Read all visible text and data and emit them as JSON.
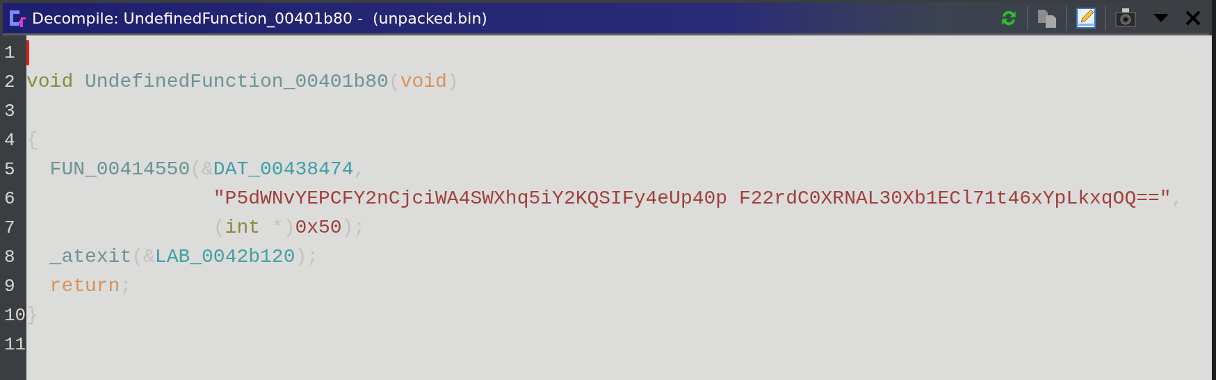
{
  "window": {
    "title": "Decompile: UndefinedFunction_00401b80 -  (unpacked.bin)"
  },
  "toolbar": [
    {
      "kind": "refresh"
    },
    {
      "kind": "copy"
    },
    {
      "kind": "edit"
    },
    {
      "kind": "snapshot"
    },
    {
      "kind": "menu"
    },
    {
      "kind": "close"
    }
  ],
  "editor": {
    "lines": [
      {
        "number": "1",
        "cursor": true
      },
      {
        "number": "2",
        "cursor": false,
        "tokens": [
          {
            "kind": "keyword",
            "text": "void"
          },
          {
            "kind": "space"
          },
          {
            "kind": "function",
            "text": "UndefinedFunction_00401b80"
          },
          {
            "kind": "punct",
            "text": "("
          },
          {
            "kind": "control",
            "text": "void"
          },
          {
            "kind": "punct",
            "text": ")"
          }
        ]
      },
      {
        "number": "3",
        "cursor": false
      },
      {
        "number": "4",
        "cursor": false,
        "tokens": [
          {
            "kind": "punct",
            "text": "{"
          }
        ]
      },
      {
        "number": "5",
        "cursor": false,
        "kind": "body",
        "tokens": [
          {
            "kind": "function",
            "text": "FUN_00414550"
          },
          {
            "kind": "punct",
            "text": "(&"
          },
          {
            "kind": "data",
            "text": "DAT_00438474"
          },
          {
            "kind": "punct",
            "text": ","
          }
        ]
      },
      {
        "number": "6",
        "cursor": false,
        "kind": "argument",
        "tokens": [
          {
            "kind": "string",
            "text": "\"P5dWNvYEPCFY2nCjciWA4SWXhq5iY2KQSIFy4eUp40p F22rdC0XRNAL30Xb1ECl71t46xYpLkxqOQ==\""
          },
          {
            "kind": "punct",
            "text": ","
          }
        ]
      },
      {
        "number": "7",
        "cursor": false,
        "kind": "argument",
        "tokens": [
          {
            "kind": "punct",
            "text": "("
          },
          {
            "kind": "keyword",
            "text": "int"
          },
          {
            "kind": "punct",
            "text": " *)"
          },
          {
            "kind": "number",
            "text": "0x50"
          },
          {
            "kind": "punct",
            "text": ");"
          }
        ]
      },
      {
        "number": "8",
        "cursor": false,
        "kind": "body",
        "tokens": [
          {
            "kind": "function",
            "text": "_atexit"
          },
          {
            "kind": "punct",
            "text": "(&"
          },
          {
            "kind": "data",
            "text": "LAB_0042b120"
          },
          {
            "kind": "punct",
            "text": ");"
          }
        ]
      },
      {
        "number": "9",
        "cursor": false,
        "kind": "body",
        "tokens": [
          {
            "kind": "control",
            "text": "return"
          },
          {
            "kind": "punct",
            "text": ";"
          }
        ]
      },
      {
        "number": "10",
        "cursor": false,
        "tokens": [
          {
            "kind": "punct",
            "text": "}"
          }
        ]
      },
      {
        "number": "11",
        "cursor": false
      }
    ]
  }
}
